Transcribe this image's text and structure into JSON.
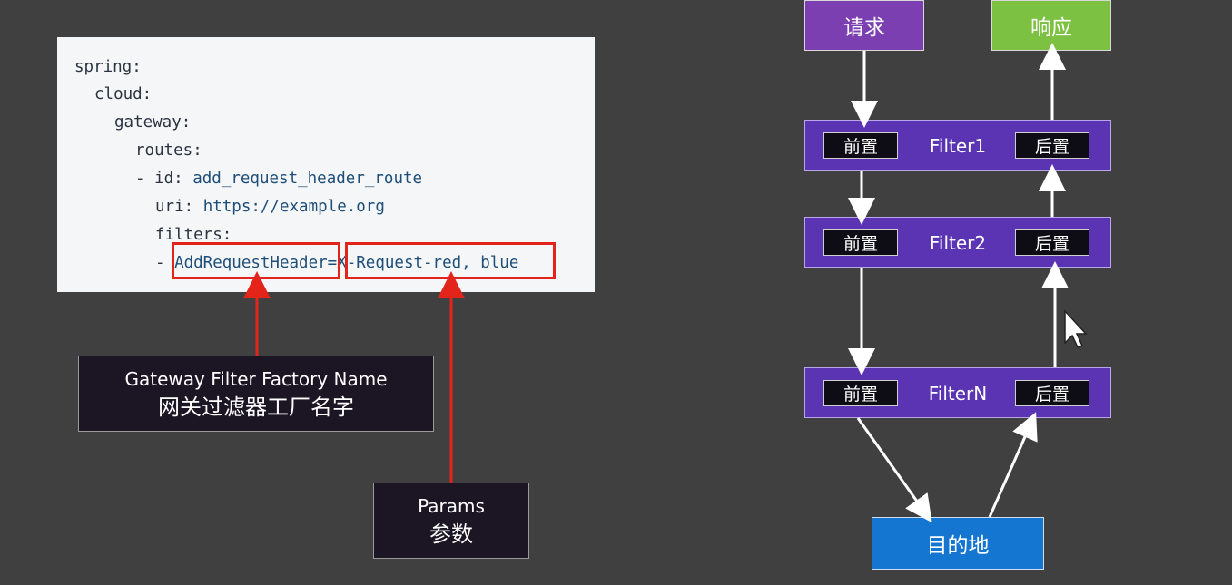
{
  "code": {
    "lines": [
      {
        "key": "spring:",
        "value": ""
      },
      {
        "key": "cloud:",
        "value": ""
      },
      {
        "key": "gateway:",
        "value": ""
      },
      {
        "key": "routes:",
        "value": ""
      },
      {
        "key": "- id: ",
        "value": "add_request_header_route"
      },
      {
        "key": "uri: ",
        "value": "https://example.org"
      },
      {
        "key": "filters:",
        "value": ""
      },
      {
        "key": "- ",
        "value": "AddRequestHeader=X-Request-red, blue"
      }
    ]
  },
  "labels": {
    "factory_en": "Gateway Filter Factory Name",
    "factory_zh": "网关过滤器工厂名字",
    "params_en": "Params",
    "params_zh": "参数"
  },
  "flow": {
    "request": "请求",
    "response": "响应",
    "filters": [
      {
        "name": "Filter1",
        "pre": "前置",
        "post": "后置"
      },
      {
        "name": "Filter2",
        "pre": "前置",
        "post": "后置"
      },
      {
        "name": "FilterN",
        "pre": "前置",
        "post": "后置"
      }
    ],
    "destination": "目的地"
  },
  "colors": {
    "request_box": "#7b3fb2",
    "response_box": "#7cc142",
    "filter_bar": "#5b34b3",
    "destination": "#1576d2",
    "highlight": "#e3241b"
  }
}
